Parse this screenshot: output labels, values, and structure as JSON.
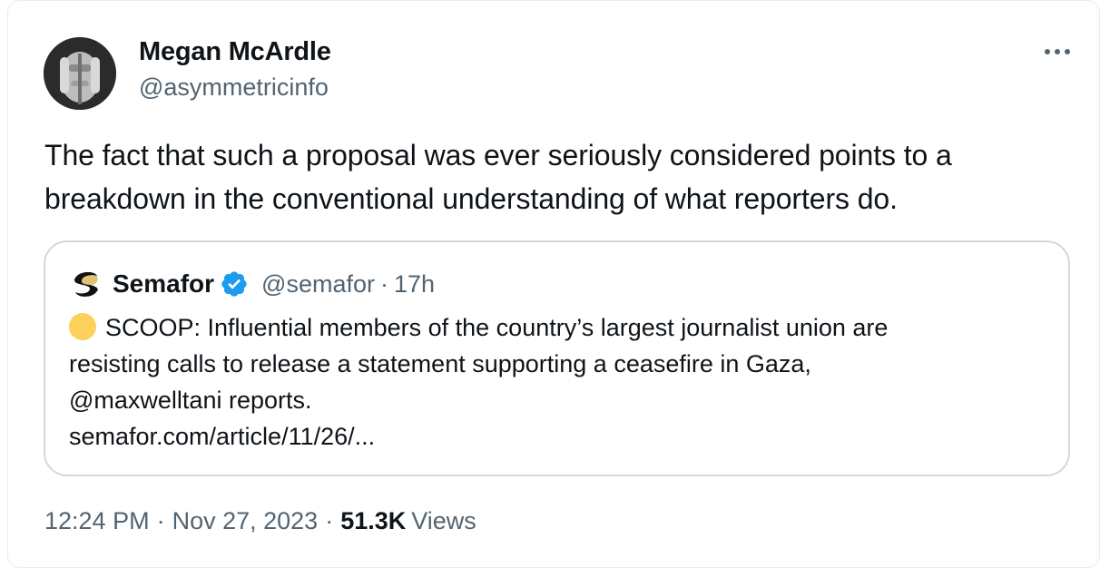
{
  "author": {
    "display_name": "Megan McArdle",
    "handle": "@asymmetricinfo",
    "avatar_icon": "profile-photo"
  },
  "tweet": {
    "text": "The fact that such a proposal was ever seriously considered points to a breakdown in the conventional understanding of what reporters do."
  },
  "quoted_tweet": {
    "logo_icon": "semafor-logo",
    "display_name": "Semafor",
    "verified_icon": "verified-badge-icon",
    "handle": "@semafor",
    "separator": "·",
    "time": "17h",
    "emoji": "yellow-circle",
    "text_lines": [
      "SCOOP: Influential members of the country’s largest journalist union are",
      "resisting calls to release a statement supporting a ceasefire in Gaza,",
      "@maxwelltani reports."
    ],
    "link": "semafor.com/article/11/26/..."
  },
  "meta": {
    "time": "12:24 PM",
    "separator": "·",
    "date": "Nov 27, 2023",
    "views_count": "51.3K",
    "views_label": "Views"
  },
  "colors": {
    "text": "#0f1419",
    "secondary": "#536471",
    "border": "#cfd9de",
    "verified": "#1d9bf0",
    "emoji_yellow": "#fcd15b"
  }
}
